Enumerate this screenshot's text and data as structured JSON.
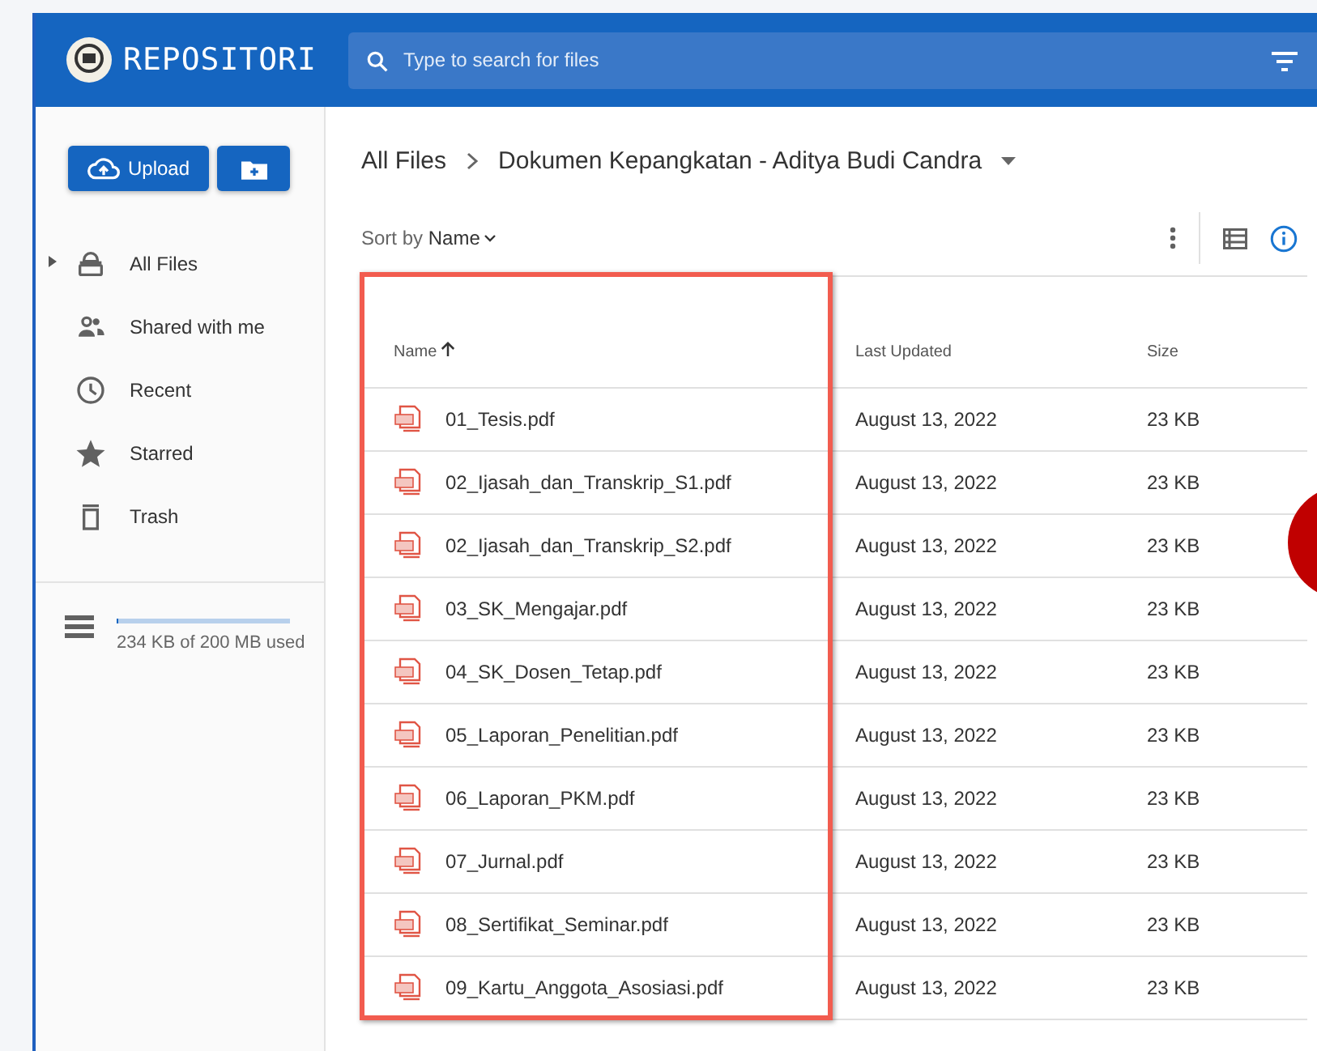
{
  "header": {
    "title": "REPOSITORI",
    "search": {
      "placeholder": "Type to search for files"
    }
  },
  "sidebar": {
    "upload_label": "Upload",
    "items": [
      {
        "label": "All Files",
        "kind": "all",
        "expanded": false,
        "selected": false
      },
      {
        "label": "Shared with me",
        "kind": "shared",
        "selected": false
      },
      {
        "label": "Recent",
        "kind": "recent",
        "selected": false
      },
      {
        "label": "Starred",
        "kind": "starred",
        "selected": false
      },
      {
        "label": "Trash",
        "kind": "trash",
        "selected": false
      }
    ],
    "storage": {
      "level": 0.002,
      "text": "234 KB of 200 MB used"
    }
  },
  "breadcrumb": [
    "All Files",
    "Dokumen Kepangkatan - Aditya Budi Candra"
  ],
  "sort": {
    "prefix": "Sort by",
    "value": "Name"
  },
  "table": {
    "columns": [
      "Name",
      "Last Updated",
      "Size"
    ],
    "rows": [
      {
        "name": "01_Tesis.pdf",
        "updated": "August 13, 2022",
        "size": "23 KB"
      },
      {
        "name": "02_Ijasah_dan_Transkrip_S1.pdf",
        "updated": "August 13, 2022",
        "size": "23 KB"
      },
      {
        "name": "02_Ijasah_dan_Transkrip_S2.pdf",
        "updated": "August 13, 2022",
        "size": "23 KB"
      },
      {
        "name": "03_SK_Mengajar.pdf",
        "updated": "August 13, 2022",
        "size": "23 KB"
      },
      {
        "name": "04_SK_Dosen_Tetap.pdf",
        "updated": "August 13, 2022",
        "size": "23 KB"
      },
      {
        "name": "05_Laporan_Penelitian.pdf",
        "updated": "August 13, 2022",
        "size": "23 KB"
      },
      {
        "name": "06_Laporan_PKM.pdf",
        "updated": "August 13, 2022",
        "size": "23 KB"
      },
      {
        "name": "07_Jurnal.pdf",
        "updated": "August 13, 2022",
        "size": "23 KB"
      },
      {
        "name": "08_Sertifikat_Seminar.pdf",
        "updated": "August 13, 2022",
        "size": "23 KB"
      },
      {
        "name": "09_Kartu_Anggota_Asosiasi.pdf",
        "updated": "August 13, 2022",
        "size": "23 KB"
      }
    ]
  }
}
